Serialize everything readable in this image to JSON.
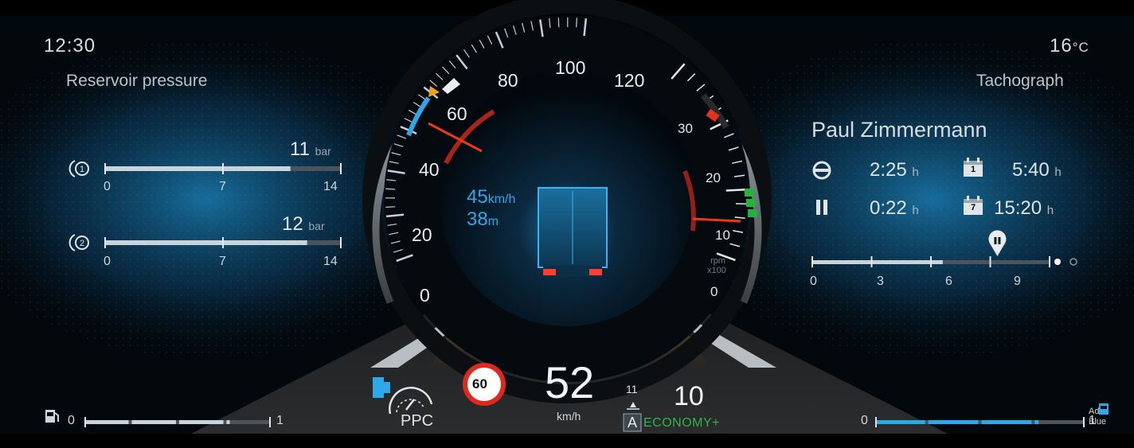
{
  "status": {
    "clock": "12:30",
    "temperature": "16",
    "temperature_unit": "°C"
  },
  "left_panel": {
    "title": "Reservoir pressure",
    "circuits": [
      {
        "id": "1",
        "value": "11",
        "unit": "bar",
        "fraction": 0.786,
        "ticks": [
          "0",
          "7",
          "14"
        ]
      },
      {
        "id": "2",
        "value": "12",
        "unit": "bar",
        "fraction": 0.857,
        "ticks": [
          "0",
          "7",
          "14"
        ]
      }
    ]
  },
  "speedometer": {
    "ticks": [
      "0",
      "20",
      "40",
      "60",
      "80",
      "100",
      "120"
    ],
    "acc_speed": "45",
    "acc_speed_unit": "km/h",
    "acc_distance": "38",
    "acc_distance_unit": "m"
  },
  "tachometer": {
    "ticks": [
      "0",
      "10",
      "20",
      "30"
    ],
    "unit_top": "rpm",
    "unit_bottom": "x100"
  },
  "right_panel": {
    "title": "Tachograph",
    "driver": "Paul Zimmermann",
    "driving_time": "2:25",
    "daily_time": "5:40",
    "break_time": "0:22",
    "weekly_time": "15:20",
    "time_unit": "h",
    "day_icon_label": "1",
    "week_icon_label": "7",
    "timeline_ticks": [
      "0",
      "3",
      "6",
      "9"
    ],
    "timeline_fraction": 0.55
  },
  "bottom": {
    "fuel_min": "0",
    "fuel_max": "1",
    "fuel_fraction": 0.78,
    "ppc_label": "PPC",
    "speed_limit": "60",
    "speed": "52",
    "speed_unit": "km/h",
    "gear_target": "11",
    "gear": "10",
    "mode_letter": "A",
    "mode_name": "ECONOMY+",
    "adblue_min": "0",
    "adblue_max": "1",
    "adblue_fraction": 0.78,
    "adblue_label_top": "Ad",
    "adblue_label_bottom": "Blue"
  },
  "colors": {
    "accent_blue": "#2ea8e8",
    "needle_red": "#e8391a",
    "redline": "#d42a1a",
    "green_zone": "#22b43c",
    "warning_orange": "#f0a020",
    "eco_green": "#2fb34a"
  }
}
